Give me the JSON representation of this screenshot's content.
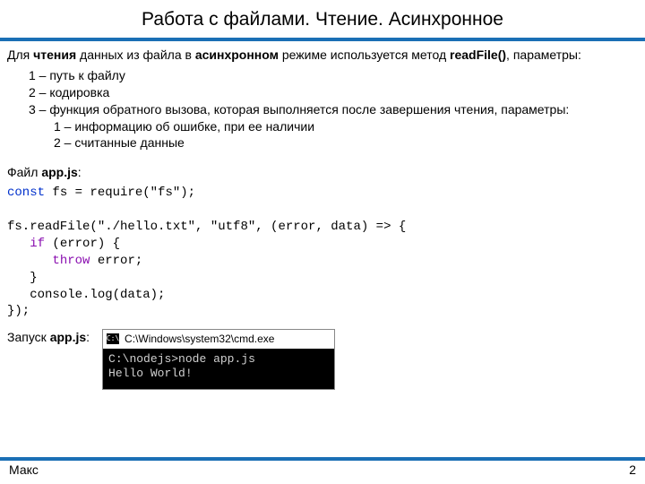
{
  "title": "Работа с файлами. Чтение. Асинхронное",
  "intro": "Для чтения данных из файла в асинхронном режиме используется метод readFile(), параметры:",
  "params": [
    "1 – путь к файлу",
    "2 – кодировка",
    "3 – функция обратного вызова, которая выполняется после завершения чтения, параметры:"
  ],
  "callback_params": [
    "1 – информацию об ошибке, при ее наличии",
    "2 – считанные данные"
  ],
  "file_label": "Файл ",
  "file_name": "app.js",
  "code": {
    "l1a": "const",
    "l1b": " fs = require(\"fs\");",
    "l2": "",
    "l3": "fs.readFile(\"./hello.txt\", \"utf8\", (error, data) => {",
    "l4a": "   ",
    "l4b": "if",
    "l4c": " (error) {",
    "l5a": "      ",
    "l5b": "throw",
    "l5c": " error;",
    "l6": "   }",
    "l7": "   console.log(data);",
    "l8": "});"
  },
  "run_label": "Запуск ",
  "run_name": "app.js",
  "console": {
    "title": " C:\\Windows\\system32\\cmd.exe",
    "line1": "C:\\nodejs>node app.js",
    "line2": "Hello World!"
  },
  "footer_left": "Макс",
  "footer_right": "2"
}
